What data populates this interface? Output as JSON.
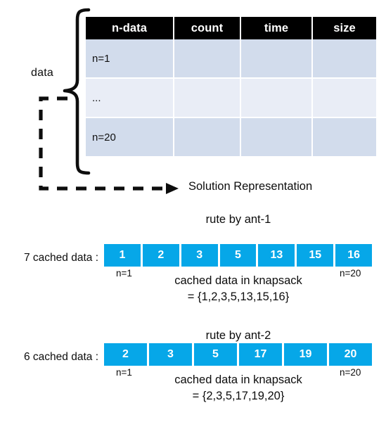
{
  "diagram": {
    "brace_label": "data",
    "solution_representation_label": "Solution Representation"
  },
  "table": {
    "headers": [
      "n-data",
      "count",
      "time",
      "size"
    ],
    "rows": [
      [
        "n=1",
        "",
        "",
        ""
      ],
      [
        "...",
        "",
        "",
        ""
      ],
      [
        "n=20",
        "",
        "",
        ""
      ]
    ],
    "header_bg": "#000000",
    "header_fg": "#ffffff",
    "row_bg_a": "#d2dcec",
    "row_bg_b": "#e9edf6"
  },
  "routes": [
    {
      "title": "rute by ant-1",
      "left_label": "7 cached data :",
      "cells": [
        "1",
        "2",
        "3",
        "5",
        "13",
        "15",
        "16"
      ],
      "start_tag": "n=1",
      "end_tag": "n=20",
      "note_line1": "cached data in knapsack",
      "note_line2": "= {1,2,3,5,13,15,16}",
      "cell_color": "#06a7e8"
    },
    {
      "title": "rute by ant-2",
      "left_label": "6 cached data :",
      "cells": [
        "2",
        "3",
        "5",
        "17",
        "19",
        "20"
      ],
      "start_tag": "n=1",
      "end_tag": "n=20",
      "note_line1": "cached data in knapsack",
      "note_line2": "= {2,3,5,17,19,20}",
      "cell_color": "#06a7e8"
    }
  ]
}
